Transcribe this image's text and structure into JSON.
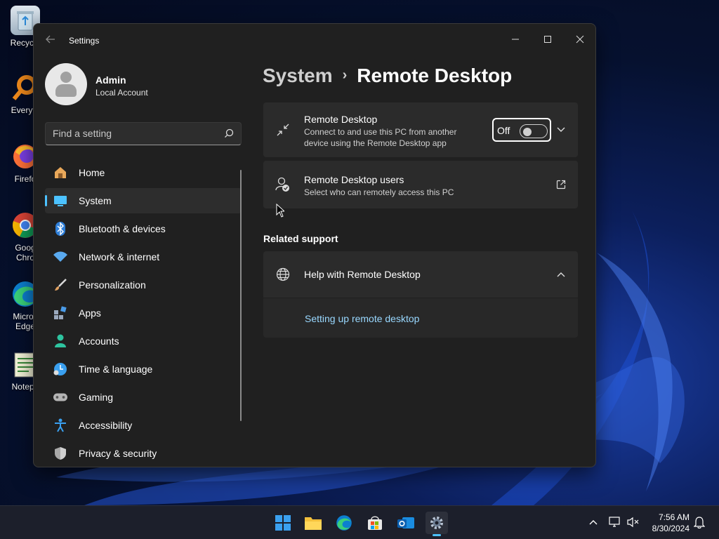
{
  "desktop": {
    "icons": [
      {
        "label": "Recycle",
        "icon": "recycle-bin-icon"
      },
      {
        "label": "Everyth",
        "icon": "everything-search-icon"
      },
      {
        "label": "Firefo",
        "icon": "firefox-icon"
      },
      {
        "label": "Goog\nChro",
        "icon": "chrome-icon"
      },
      {
        "label": "Micros\nEdge",
        "icon": "edge-icon"
      },
      {
        "label": "Notepa",
        "icon": "notepad-icon"
      }
    ]
  },
  "window": {
    "title": "Settings",
    "controls": {
      "minimize": "—",
      "maximize": "☐",
      "close": "✕"
    }
  },
  "profile": {
    "name": "Admin",
    "account": "Local Account"
  },
  "search": {
    "placeholder": "Find a setting"
  },
  "nav": {
    "items": [
      {
        "label": "Home",
        "icon": "home-icon",
        "color": "#e8a34a"
      },
      {
        "label": "System",
        "icon": "system-icon",
        "color": "#4cc2ff",
        "active": true
      },
      {
        "label": "Bluetooth & devices",
        "icon": "bluetooth-icon",
        "color": "#3a8dde"
      },
      {
        "label": "Network & internet",
        "icon": "wifi-icon",
        "color": "#5aaaf0"
      },
      {
        "label": "Personalization",
        "icon": "brush-icon",
        "color": "#e0a060"
      },
      {
        "label": "Apps",
        "icon": "apps-icon",
        "color": "#8aa0c0"
      },
      {
        "label": "Accounts",
        "icon": "accounts-icon",
        "color": "#2ec4a0"
      },
      {
        "label": "Time & language",
        "icon": "time-language-icon",
        "color": "#3aa0f0"
      },
      {
        "label": "Gaming",
        "icon": "gaming-icon",
        "color": "#b0b0b0"
      },
      {
        "label": "Accessibility",
        "icon": "accessibility-icon",
        "color": "#3aa0f0"
      },
      {
        "label": "Privacy & security",
        "icon": "shield-icon",
        "color": "#a0a0a0"
      }
    ]
  },
  "breadcrumb": {
    "parent": "System",
    "separator": "›",
    "current": "Remote Desktop"
  },
  "remote_desktop_card": {
    "title": "Remote Desktop",
    "description": "Connect to and use this PC from another device using the Remote Desktop app",
    "toggle_label": "Off",
    "toggle_on": false
  },
  "users_card": {
    "title": "Remote Desktop users",
    "description": "Select who can remotely access this PC"
  },
  "related_support": {
    "heading": "Related support",
    "help_title": "Help with Remote Desktop",
    "link": "Setting up remote desktop"
  },
  "taskbar": {
    "apps": [
      {
        "icon": "windows-start-icon"
      },
      {
        "icon": "file-explorer-icon"
      },
      {
        "icon": "edge-icon"
      },
      {
        "icon": "microsoft-store-icon"
      },
      {
        "icon": "outlook-icon"
      },
      {
        "icon": "settings-gear-icon",
        "active": true
      }
    ],
    "time": "7:56 AM",
    "date": "8/30/2024"
  },
  "colors": {
    "accent": "#4cc2ff",
    "link": "#99d8ff",
    "window_bg": "#202020",
    "card_bg": "#2b2b2b"
  }
}
